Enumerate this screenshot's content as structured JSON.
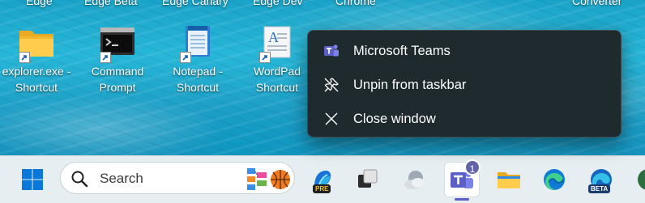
{
  "desktop": {
    "top_labels": [
      "Edge",
      "Edge Beta",
      "Edge Canary",
      "Edge Dev",
      "Chrome",
      "Converter"
    ],
    "icons": [
      {
        "line1": "explorer.exe -",
        "line2": "Shortcut",
        "icon": "folder-icon"
      },
      {
        "line1": "Command",
        "line2": "Prompt",
        "icon": "terminal-icon"
      },
      {
        "line1": "Notepad -",
        "line2": "Shortcut",
        "icon": "notepad-icon"
      },
      {
        "line1": "WordPad",
        "line2": "Shortcut",
        "icon": "wordpad-icon"
      }
    ]
  },
  "context_menu": {
    "items": [
      {
        "label": "Microsoft Teams",
        "icon": "teams-icon"
      },
      {
        "label": "Unpin from taskbar",
        "icon": "unpin-icon"
      },
      {
        "label": "Close window",
        "icon": "close-icon"
      }
    ]
  },
  "taskbar": {
    "search_placeholder": "Search",
    "apps": [
      {
        "name": "start-button",
        "icon": "windows-logo-icon"
      },
      {
        "name": "copilot-pre",
        "icon": "copilot-icon",
        "badge": "PRE"
      },
      {
        "name": "task-view",
        "icon": "task-view-icon"
      },
      {
        "name": "weather",
        "icon": "weather-icon"
      },
      {
        "name": "microsoft-teams",
        "icon": "teams-icon",
        "badge": "1",
        "active": true
      },
      {
        "name": "file-explorer",
        "icon": "folder-icon"
      },
      {
        "name": "edge",
        "icon": "edge-icon"
      },
      {
        "name": "edge-beta",
        "icon": "edge-beta-icon",
        "badge": "BETA"
      }
    ]
  },
  "colors": {
    "menu_bg": "#1f2a2e",
    "taskbar_bg": "#e6eef1",
    "teams_purple": "#5b5fc7",
    "windows_blue": "#0078d4"
  }
}
